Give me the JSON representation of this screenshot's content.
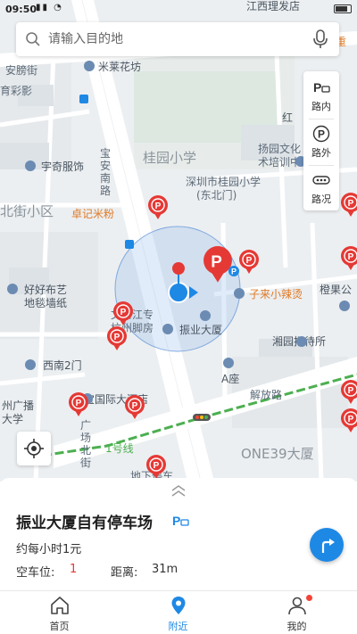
{
  "status": {
    "time": "09:50"
  },
  "search": {
    "placeholder": "请输入目的地"
  },
  "side_controls": [
    {
      "label": "路内",
      "icon": "roadside-parking-icon"
    },
    {
      "label": "路外",
      "icon": "parking-lot-icon"
    },
    {
      "label": "路况",
      "icon": "traffic-icon"
    }
  ],
  "map_labels": {
    "edge_top": "江西理发店",
    "edge_chong": "重",
    "anpu": "安膀街",
    "caiying": "育彩影",
    "milaihuafang": "米莱花坊",
    "hong": "红",
    "yangyuan": "扬园文化",
    "art_vocational": "术培训中",
    "guiyuan_primary": "桂园小学",
    "shenzhen_guiyuan": "深圳市桂园小学",
    "dongbeimen": "(东北门)",
    "baoan_south_road": "宝安南路",
    "yuqi_clothing": "宇奇服饰",
    "xijie_community": "北街小区",
    "zhuoji_rice": "卓记米粉",
    "haohao_fabric": "好好布艺",
    "ditan_wall": "地毯墙纸",
    "zilai_spicy": "子来小辣烫",
    "cheng_gong": "橙果公",
    "wenshi_jiang": "文士江专",
    "chujiao_lane": "杭州脚房",
    "zhenye_building": "振业大厦",
    "xiangyuan_hostel": "湘园招待所",
    "xinan_gate": "西南2门",
    "guangbo": "州广播",
    "daxue": "大学",
    "anbao_hotel": "安宝国际大酒店",
    "a_seat": "A座",
    "jiefang_road": "解放路",
    "guangdong_north": "广场北街",
    "line1": "1号线",
    "one39": "ONE39大厦",
    "dizhan": "地下停车"
  },
  "selected_lot": {
    "name": "振业大厦自有停车场",
    "price": "约每小时1元",
    "spaces_label": "空车位:",
    "spaces_value": "1",
    "distance_label": "距离:",
    "distance_value": "31m"
  },
  "tabs": [
    {
      "label": "首页",
      "active": false,
      "icon": "home-icon"
    },
    {
      "label": "附近",
      "active": true,
      "icon": "location-pin-icon"
    },
    {
      "label": "我的",
      "active": false,
      "icon": "user-icon",
      "badge": true
    }
  ],
  "colors": {
    "accent": "#1e88e5",
    "parking_pin": "#e53935",
    "status_red": "#e53935"
  }
}
